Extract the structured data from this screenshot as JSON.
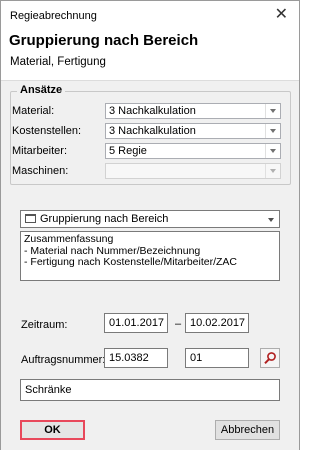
{
  "window": {
    "title": "Regieabrechnung",
    "close_glyph": "✕"
  },
  "header": {
    "title": "Gruppierung nach Bereich",
    "subtitle": "Material, Fertigung"
  },
  "ansaetze": {
    "legend": "Ansätze",
    "rows": [
      {
        "label": "Material:",
        "value": "3 Nachkalkulation"
      },
      {
        "label": "Kostenstellen:",
        "value": "3 Nachkalkulation"
      },
      {
        "label": "Mitarbeiter:",
        "value": "5 Regie"
      },
      {
        "label": "Maschinen:",
        "value": ""
      }
    ]
  },
  "grouping": {
    "value": "Gruppierung nach Bereich",
    "icon": "window-icon"
  },
  "summary": {
    "lines": [
      "Zusammenfassung",
      "- Material nach Nummer/Bezeichnung",
      "- Fertigung nach Kostenstelle/Mitarbeiter/ZAC"
    ]
  },
  "zeitraum": {
    "label": "Zeitraum:",
    "from": "01.01.2017",
    "separator": "–",
    "to": "10.02.2017"
  },
  "auftrag": {
    "label": "Auftragsnummer:",
    "number": "15.0382",
    "sub": "01",
    "search_icon": "magnifier-icon"
  },
  "status_field": {
    "value": "Schränke"
  },
  "buttons": {
    "ok": "OK",
    "cancel": "Abbrechen"
  }
}
